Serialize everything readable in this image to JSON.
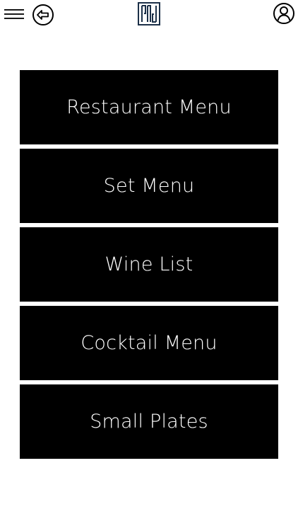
{
  "header": {
    "icons": {
      "menu": "hamburger-menu-icon",
      "back": "back-arrow-icon",
      "logo": "logo-icon",
      "profile": "user-profile-icon"
    },
    "logo_color": "#1c3048"
  },
  "menu": {
    "items": [
      {
        "label": "Restaurant Menu"
      },
      {
        "label": "Set Menu"
      },
      {
        "label": "Wine List"
      },
      {
        "label": "Cocktail Menu"
      },
      {
        "label": "Small Plates"
      }
    ],
    "button_bg": "#000000",
    "button_text_color": "#ffffff"
  }
}
